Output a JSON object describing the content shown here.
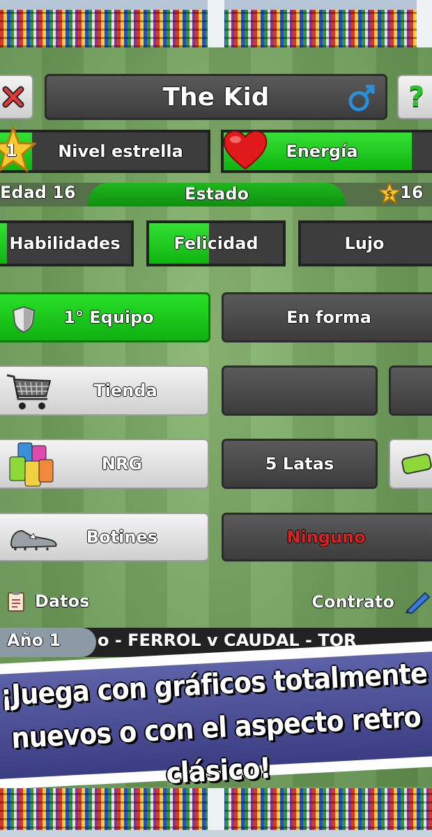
{
  "header": {
    "player_name": "The Kid"
  },
  "stats": {
    "star_level": "1",
    "star_label": "Nivel estrella",
    "energy_label": "Energía",
    "energy_level": 0.85,
    "age_label": "Edad 16",
    "status_label": "Estado",
    "money": "16"
  },
  "status_bars": [
    {
      "label": "Habilidades",
      "level": 0.05
    },
    {
      "label": "Felicidad",
      "level": 0.43
    },
    {
      "label": "Lujo",
      "level": 0.0
    }
  ],
  "team": {
    "team_label": "1° Equipo",
    "form_label": "En forma"
  },
  "actions": {
    "shop_label": "Tienda",
    "nrg_label": "NRG",
    "nrg_count": "5 Latas",
    "boots_label": "Botines",
    "boots_value": "Ninguno",
    "boots_value_color": "#e02020"
  },
  "footer": {
    "data_label": "Datos",
    "contract_label": "Contrato"
  },
  "ticker": {
    "year_label": "Año 1",
    "text": "o - FERROL v CAUDAL - TOR"
  },
  "promo": {
    "line1": "¡Juega con gráficos totalmente",
    "line2": "nuevos o con el aspecto retro clásico!"
  },
  "colors": {
    "accent_green": "#1ac81a",
    "male_symbol": "#2a8fd8",
    "heart": "#e01a1a"
  }
}
